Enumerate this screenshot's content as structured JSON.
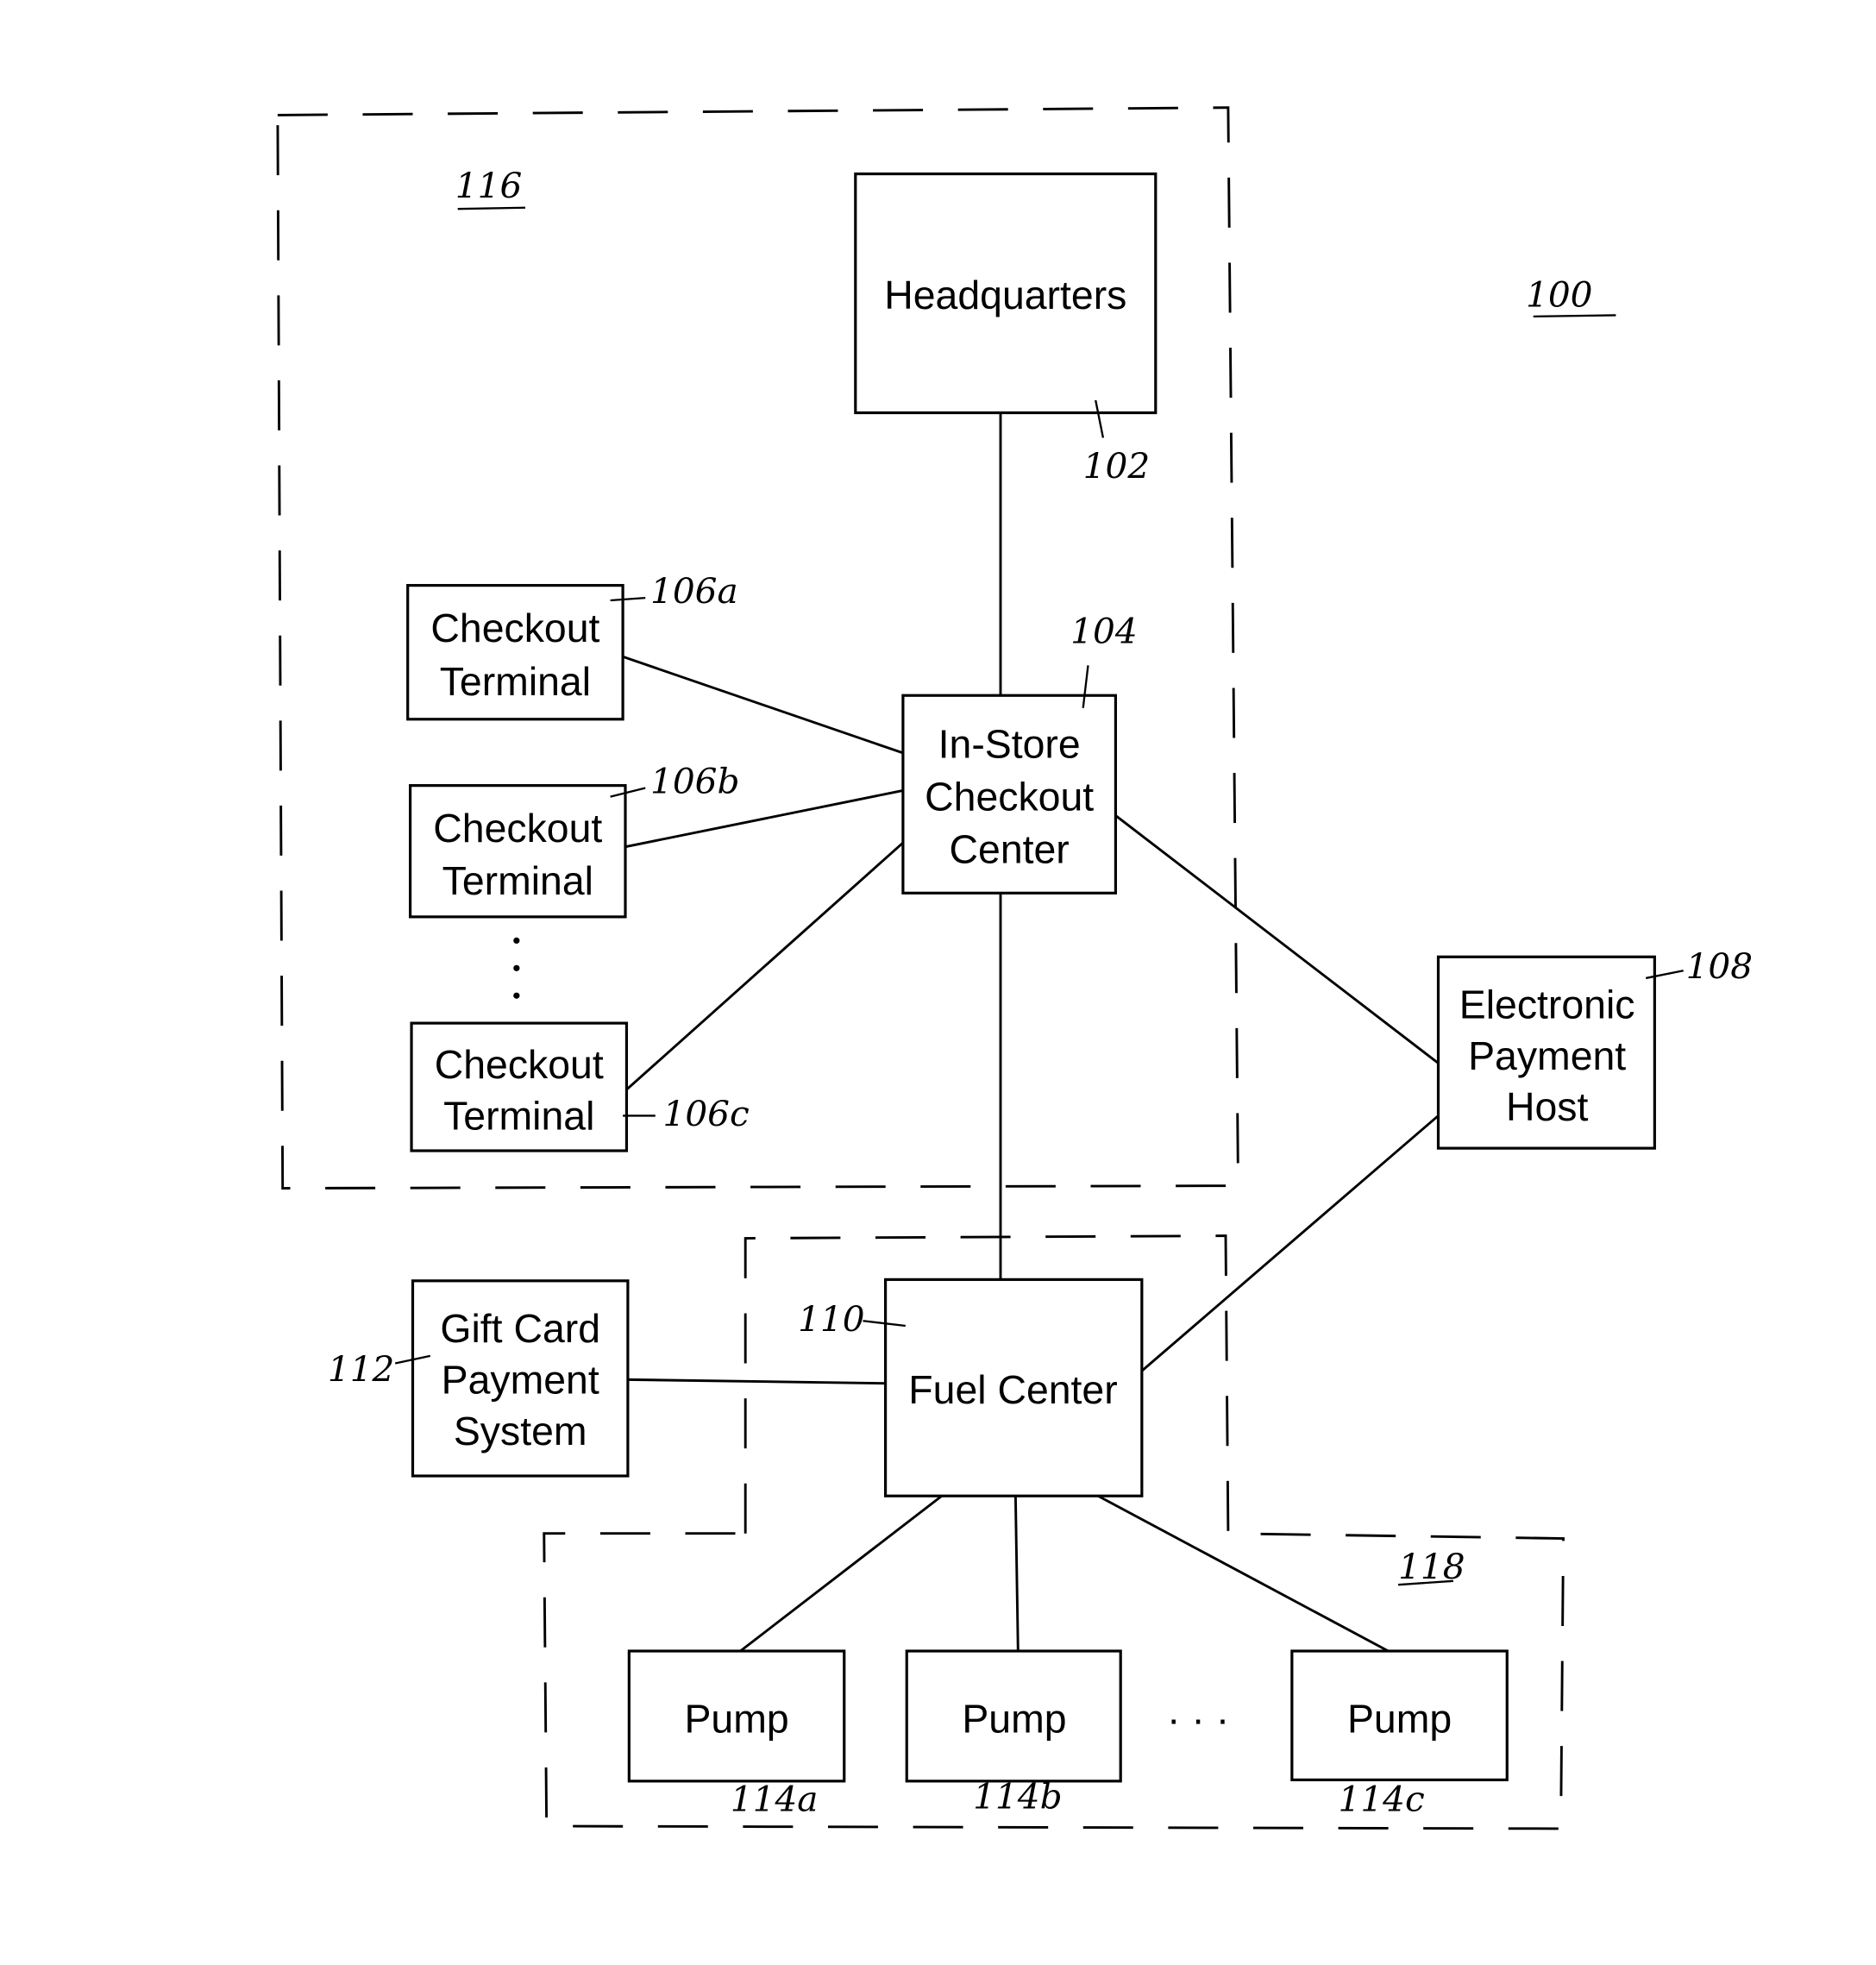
{
  "figure": {
    "system_ref": "100",
    "regions": {
      "store": "116",
      "fuel": "118"
    },
    "nodes": {
      "headquarters": {
        "label": [
          "Headquarters"
        ],
        "ref": "102"
      },
      "checkout_center": {
        "label": [
          "In-Store",
          "Checkout",
          "Center"
        ],
        "ref": "104"
      },
      "terminal_a": {
        "label": [
          "Checkout",
          "Terminal"
        ],
        "ref": "106a"
      },
      "terminal_b": {
        "label": [
          "Checkout",
          "Terminal"
        ],
        "ref": "106b"
      },
      "terminal_c": {
        "label": [
          "Checkout",
          "Terminal"
        ],
        "ref": "106c"
      },
      "payment_host": {
        "label": [
          "Electronic",
          "Payment",
          "Host"
        ],
        "ref": "108"
      },
      "fuel_center": {
        "label": [
          "Fuel Center"
        ],
        "ref": "110"
      },
      "gift_card": {
        "label": [
          "Gift Card",
          "Payment",
          "System"
        ],
        "ref": "112"
      },
      "pump_a": {
        "label": [
          "Pump"
        ],
        "ref": "114a"
      },
      "pump_b": {
        "label": [
          "Pump"
        ],
        "ref": "114b"
      },
      "pump_c": {
        "label": [
          "Pump"
        ],
        "ref": "114c"
      }
    },
    "ellipsis": "· · ·"
  }
}
